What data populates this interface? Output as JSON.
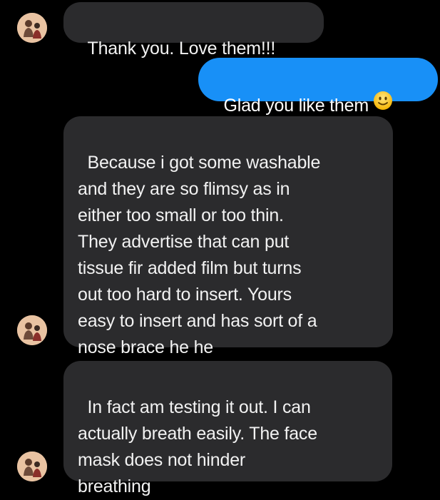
{
  "conversation": {
    "messages": [
      {
        "direction": "incoming",
        "text": "Thank you. Love them!!!"
      },
      {
        "direction": "outgoing",
        "text": "Glad you like them",
        "emoji": "slightly-smiling-face-icon"
      },
      {
        "direction": "incoming",
        "text": "Because i got some washable\nand they are so flimsy as in\neither too small or too thin.\nThey advertise that can put\ntissue fir added film but turns\nout too hard to insert. Yours\neasy to insert and has sort of a\nnose brace he he"
      },
      {
        "direction": "incoming",
        "text": "In fact am testing it out. I can\nactually breath easily. The face\nmask does not hinder\nbreathing"
      }
    ]
  },
  "colors": {
    "background": "#000000",
    "incoming_bubble": "#2b2b2d",
    "outgoing_bubble": "#1890f7",
    "text": "#f2f2f2"
  }
}
